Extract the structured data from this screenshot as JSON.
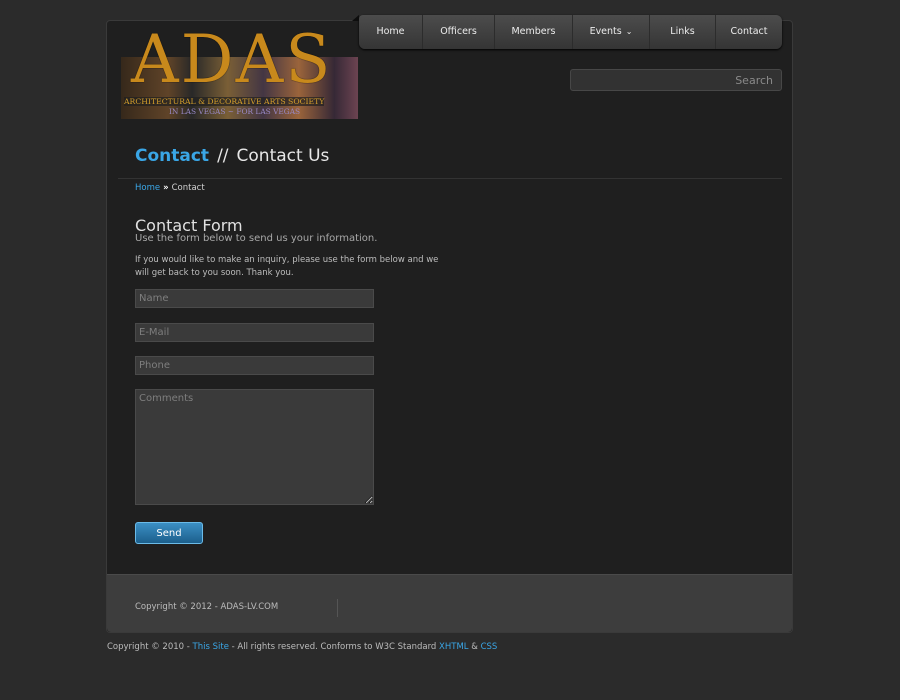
{
  "nav": {
    "items": [
      {
        "label": "Home"
      },
      {
        "label": "Officers"
      },
      {
        "label": "Members"
      },
      {
        "label": "Events"
      },
      {
        "label": "Links"
      },
      {
        "label": "Contact"
      }
    ]
  },
  "logo": {
    "letters": "ADAS",
    "line1": "ARCHITECTURAL & DECORATIVE ARTS SOCIETY",
    "line2": "IN LAS VEGAS ~ FOR LAS VEGAS"
  },
  "search": {
    "placeholder": "Search"
  },
  "heading": {
    "section": "Contact",
    "separator": "//",
    "title": "Contact Us"
  },
  "breadcrumb": {
    "home": "Home",
    "separator": "»",
    "current": "Contact"
  },
  "form": {
    "title": "Contact Form",
    "subtitle": "Use the form below to send us your information.",
    "intro": "If you would like to make an inquiry, please use the form below and we will get back to you soon.  Thank you.",
    "name_placeholder": "Name",
    "email_placeholder": "E-Mail",
    "phone_placeholder": "Phone",
    "comments_placeholder": "Comments",
    "send_label": "Send"
  },
  "footer": {
    "copyright": "Copyright © 2012 - ADAS-LV.COM"
  },
  "bottom": {
    "prefix": "Copyright © 2010 - ",
    "site_link": "This Site",
    "middle": " - All rights reserved. Conforms to W3C Standard ",
    "xhtml": "XHTML",
    "amp": " & ",
    "css": "CSS"
  },
  "colors": {
    "accent": "#3aa6e6",
    "background": "#2b2b2b",
    "panel": "#1f1f1f"
  }
}
